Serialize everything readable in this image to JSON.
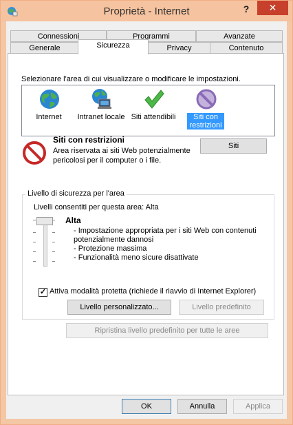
{
  "window": {
    "title": "Proprietà - Internet",
    "help_glyph": "?",
    "close_glyph": "✕"
  },
  "tabs_top": [
    "Connessioni",
    "Programmi",
    "Avanzate"
  ],
  "tabs_bottom": [
    "Generale",
    "Sicurezza",
    "Privacy",
    "Contenuto"
  ],
  "zones": {
    "instruction": "Selezionare l'area di cui visualizzare o modificare le impostazioni.",
    "items": [
      {
        "label": "Internet",
        "icon": "globe-icon"
      },
      {
        "label": "Intranet locale",
        "icon": "intranet-icon"
      },
      {
        "label": "Siti attendibili",
        "icon": "checkmark-icon"
      },
      {
        "label": "Siti con restrizioni",
        "icon": "restricted-icon",
        "selected": true
      }
    ]
  },
  "zone_info": {
    "title": "Siti con restrizioni",
    "description_line1": "Area riservata ai siti Web potenzialmente",
    "description_line2": "pericolosi per il computer o i file.",
    "sites_button": "Siti"
  },
  "security_level": {
    "group_title": "Livello di sicurezza per l'area",
    "allowed_levels": "Livelli consentiti per questa area: Alta",
    "level_name": "Alta",
    "bullets": [
      "- Impostazione appropriata per i siti Web con contenuti",
      "potenzialmente dannosi",
      "- Protezione massima",
      "- Funzionalità meno sicure disattivate"
    ],
    "protected_mode_label": "Attiva modalità protetta (richiede il riavvio di Internet Explorer)",
    "protected_mode_checked": true,
    "custom_level_button": "Livello personalizzato...",
    "default_level_button": "Livello predefinito"
  },
  "reset_all_button": "Ripristina livello predefinito per tutte le aree",
  "footer": {
    "ok": "OK",
    "cancel": "Annulla",
    "apply": "Applica"
  }
}
